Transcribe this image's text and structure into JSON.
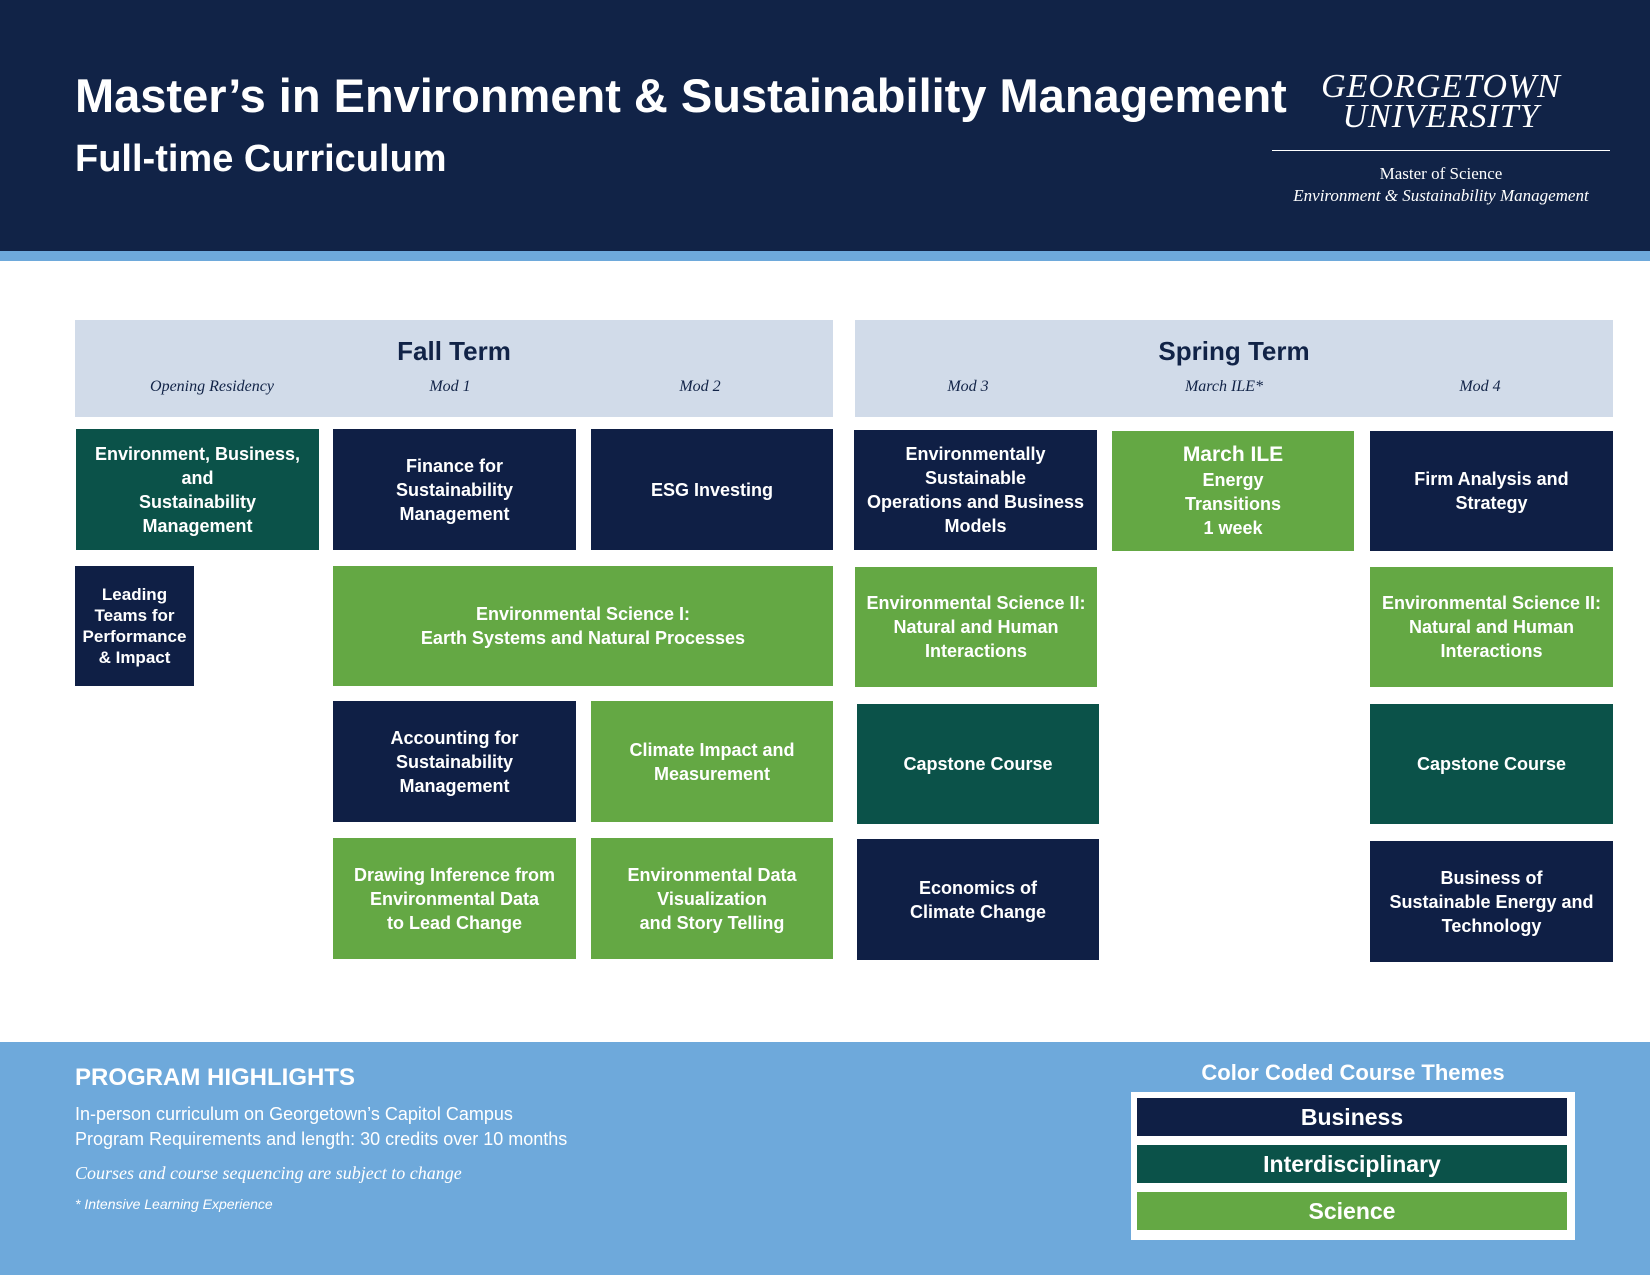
{
  "header": {
    "title": "Master’s in Environment & Sustainability Management",
    "subtitle": "Full-time Curriculum",
    "logo": {
      "line1": "GEORGETOWN",
      "line2": "UNIVERSITY",
      "sub1": "Master of Science",
      "sub2": "Environment & Sustainability Management"
    }
  },
  "terms": {
    "fall": {
      "title": "Fall Term",
      "mods": [
        "Opening Residency",
        "Mod 1",
        "Mod 2"
      ]
    },
    "spring": {
      "title": "Spring Term",
      "mods": [
        "Mod 3",
        "March ILE*",
        "Mod 4"
      ]
    }
  },
  "courses": {
    "env_business": {
      "text": "Environment, Business, and\nSustainability Management",
      "theme": "Interdisciplinary"
    },
    "leading_teams": {
      "text": "Leading\nTeams for\nPerformance\n& Impact",
      "theme": "Business"
    },
    "finance": {
      "text": "Finance for\nSustainability\nManagement",
      "theme": "Business"
    },
    "esg": {
      "text": "ESG Investing",
      "theme": "Business"
    },
    "env_sci_1": {
      "text": "Environmental Science I:\nEarth Systems and Natural Processes",
      "theme": "Science"
    },
    "accounting": {
      "text": "Accounting for\nSustainability\nManagement",
      "theme": "Business"
    },
    "climate_impact": {
      "text": "Climate Impact and\nMeasurement",
      "theme": "Science"
    },
    "drawing_inference": {
      "text": "Drawing Inference from\nEnvironmental Data\nto Lead Change",
      "theme": "Science"
    },
    "env_data_viz": {
      "text": "Environmental Data\nVisualization\nand Story Telling",
      "theme": "Science"
    },
    "env_sustainable_ops": {
      "text": "Environmentally Sustainable\nOperations and Business\nModels",
      "theme": "Business"
    },
    "march_ile": {
      "title": "March ILE",
      "text": "Energy\nTransitions\n1 week",
      "theme": "Science"
    },
    "firm_analysis": {
      "text": "Firm Analysis and Strategy",
      "theme": "Business"
    },
    "env_sci_2_mod3": {
      "text": "Environmental Science II:\nNatural and Human\nInteractions",
      "theme": "Science"
    },
    "env_sci_2_mod4": {
      "text": "Environmental Science II:\nNatural and Human\nInteractions",
      "theme": "Science"
    },
    "capstone_mod3": {
      "text": "Capstone Course",
      "theme": "Interdisciplinary"
    },
    "capstone_mod4": {
      "text": "Capstone Course",
      "theme": "Interdisciplinary"
    },
    "economics_climate": {
      "text": "Economics of\nClimate Change",
      "theme": "Business"
    },
    "business_energy": {
      "text": "Business of\nSustainable Energy and\nTechnology",
      "theme": "Business"
    }
  },
  "highlights": {
    "title": "PROGRAM HIGHLIGHTS",
    "line1": "In-person curriculum on Georgetown’s Capitol Campus",
    "line2": "Program Requirements and length: 30 credits over 10 months",
    "note": "Courses and course sequencing are subject to change",
    "footnote": "* Intensive Learning Experience"
  },
  "legend": {
    "title": "Color Coded Course Themes",
    "items": [
      "Business",
      "Interdisciplinary",
      "Science"
    ]
  },
  "colors": {
    "navy_header": "#112347",
    "light_blue": "#6ea9db",
    "term_band": "#d1dbe9",
    "business": "#0f1f45",
    "interdisciplinary": "#0b5249",
    "science": "#64a844"
  }
}
